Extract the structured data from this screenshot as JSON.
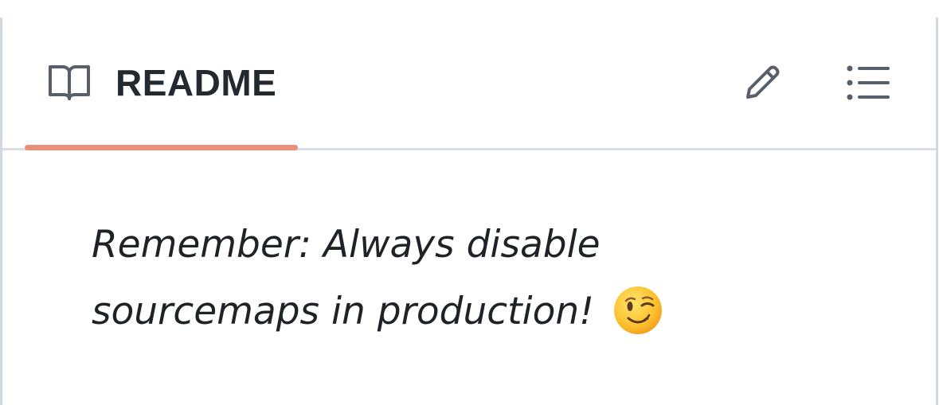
{
  "readme_panel": {
    "tab": {
      "label": "README",
      "icon": "book-icon",
      "active_underline_color": "#e8917a"
    },
    "actions": [
      {
        "name": "edit",
        "icon": "pencil-icon"
      },
      {
        "name": "outline",
        "icon": "list-icon"
      }
    ],
    "body": {
      "line1": "Remember: Always disable",
      "line2": "sourcemaps in production!",
      "emoji": "winking-face-emoji"
    }
  },
  "colors": {
    "border": "#d0d7de",
    "text": "#1f2328",
    "icon": "#57606a",
    "accent": "#e8917a"
  }
}
